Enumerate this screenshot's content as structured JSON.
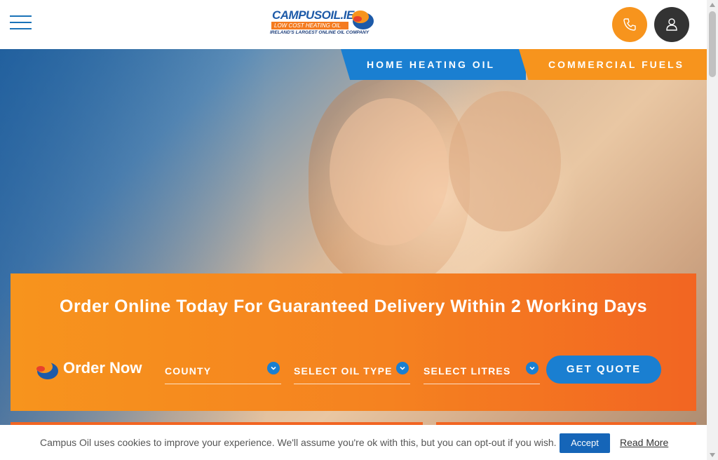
{
  "header": {
    "logo": {
      "name": "CAMPUSOIL.IE",
      "tagline": "LOW COST HEATING OIL",
      "subtagline": "IRELAND'S LARGEST ONLINE OIL COMPANY"
    },
    "menu_icon": "hamburger-icon",
    "phone_icon": "phone-icon",
    "account_icon": "user-icon"
  },
  "tabs": [
    {
      "label": "HOME HEATING OIL",
      "color": "#1a7fd1"
    },
    {
      "label": "COMMERCIAL FUELS",
      "color": "#f7941d"
    }
  ],
  "order": {
    "heading": "Order Online Today For Guaranteed Delivery Within 2 Working Days",
    "order_now_label": "Order Now",
    "selects": [
      {
        "label": "COUNTY"
      },
      {
        "label": "SELECT OIL TYPE"
      },
      {
        "label": "SELECT LITRES"
      }
    ],
    "button": "GET QUOTE"
  },
  "cookie": {
    "text": "Campus Oil uses cookies to improve your experience. We'll assume you're ok with this, but you can opt-out if you wish.",
    "accept": "Accept",
    "read_more": "Read More"
  },
  "colors": {
    "brand_orange": "#f7941d",
    "brand_blue": "#1a7fd1",
    "dark": "#333333"
  }
}
